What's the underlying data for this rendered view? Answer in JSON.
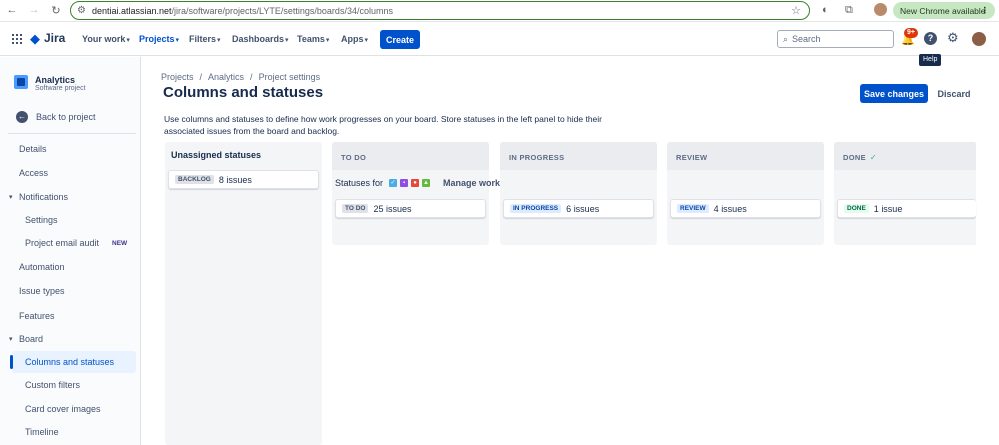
{
  "browser": {
    "url_host": "dentiai.atlassian.net",
    "url_path": "/jira/software/projects/LYTE/settings/boards/34/columns",
    "update_label": "New Chrome available"
  },
  "topnav": {
    "logo": "Jira",
    "items": [
      "Your work",
      "Projects",
      "Filters",
      "Dashboards",
      "Teams",
      "Apps"
    ],
    "create": "Create",
    "search_placeholder": "Search",
    "notif_count": "9+",
    "help_tooltip": "Help"
  },
  "sidebar": {
    "project_name": "Analytics",
    "project_type": "Software project",
    "back": "Back to project",
    "items": {
      "details": "Details",
      "access": "Access",
      "notifications": "Notifications",
      "settings": "Settings",
      "email_audit": "Project email audit",
      "new_badge": "NEW",
      "automation": "Automation",
      "issue_types": "Issue types",
      "features": "Features",
      "board": "Board",
      "columns": "Columns and statuses",
      "custom_filters": "Custom filters",
      "card_cover": "Card cover images",
      "timeline": "Timeline"
    }
  },
  "main": {
    "breadcrumb": [
      "Projects",
      "/",
      "Analytics",
      "/",
      "Project settings"
    ],
    "title": "Columns and statuses",
    "save": "Save changes",
    "discard": "Discard",
    "description": "Use columns and statuses to define how work progresses on your board. Store statuses in the left panel to hide their associated issues from the board and backlog.",
    "unassigned_title": "Unassigned statuses",
    "backlog": {
      "lozenge": "BACKLOG",
      "count": "8",
      "unit": "issues"
    },
    "statuses_for": "Statuses for",
    "manage_workflow": "Manage workflow",
    "columns": [
      {
        "title": "TO DO",
        "lozenge": "TO DO",
        "count": "25",
        "unit": "issues"
      },
      {
        "title": "IN PROGRESS",
        "lozenge": "IN PROGRESS",
        "count": "6",
        "unit": "issues"
      },
      {
        "title": "REVIEW",
        "lozenge": "REVIEW",
        "count": "4",
        "unit": "issues"
      },
      {
        "title": "DONE",
        "lozenge": "DONE",
        "count": "1",
        "unit": "issue"
      }
    ]
  },
  "colors": {
    "brand": "#0052cc",
    "done": "#36b37e"
  }
}
